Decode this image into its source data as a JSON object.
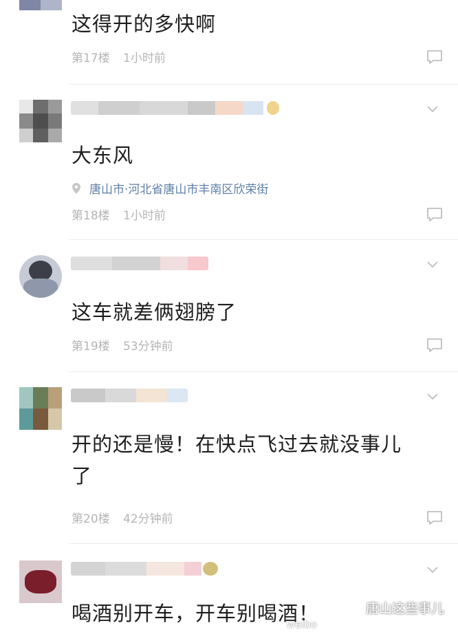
{
  "comments": [
    {
      "text": "这得开的多快啊",
      "floor": "第17楼",
      "time": "1小时前"
    },
    {
      "text": "大东风",
      "location": "唐山市·河北省唐山市丰南区欣荣街",
      "floor": "第18楼",
      "time": "1小时前"
    },
    {
      "text": "这车就差俩翅膀了",
      "floor": "第19楼",
      "time": "53分钟前"
    },
    {
      "text_line1": "开的还是慢！在快点飞过去就没事儿",
      "text_line2": "了",
      "floor": "第20楼",
      "time": "42分钟前"
    },
    {
      "text": "喝酒别开车，开车别喝酒！"
    }
  ],
  "watermark": {
    "label": "唐山这些事儿",
    "small": "weibo"
  },
  "colors": {
    "meta": "#b5b5b5",
    "location": "#5f7fa8",
    "separator": "#ececec"
  }
}
